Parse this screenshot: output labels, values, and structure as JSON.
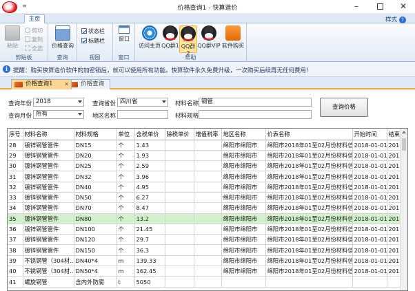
{
  "window": {
    "title": "价格查询1 - 快算造价",
    "qat": "≡",
    "min_icon": "–",
    "close_icon": "✕",
    "logo_text": "造价"
  },
  "ribbon": {
    "tabs": [
      "主页"
    ],
    "style_label": "样式",
    "help_q": "?",
    "groups": {
      "clipboard": {
        "label": "剪贴板",
        "paste": "粘贴",
        "cut": "剪切",
        "copy": "复制",
        "select_all": "全选"
      },
      "query": {
        "label": "查询",
        "price_query": "价格查询"
      },
      "view": {
        "label": "视图",
        "status_bar": "状态栏",
        "title_bar": "标题栏"
      },
      "window": {
        "label": "窗口",
        "window_btn": "窗口",
        "window_btn2": "窗口"
      },
      "help": {
        "label": "帮助",
        "home": "访问主页",
        "qq1": "QQ群1",
        "qq2": "QQ群2",
        "qq_vip": "QQ群VIP",
        "buy": "软件购买"
      }
    }
  },
  "notice": {
    "icon": "i",
    "text": "提醒：购买快算造价软件的加密锁后，就可以使用所有功能。快算软件永久免费升级，一次购买后续再无任何费用！"
  },
  "doc_tabs": [
    {
      "label": "价格查询1",
      "close": "✕"
    },
    {
      "label": "价格查询2"
    }
  ],
  "query": {
    "year_label": "查询年份",
    "year_value": "2018",
    "province_label": "查询省份",
    "province_value": "四川省",
    "month_label": "查询月份",
    "month_value": "所有",
    "region_label": "地区名称",
    "region_value": "",
    "material_label": "材料名称",
    "material_value": "钢管",
    "spec_label": "材料规格",
    "spec_value": "",
    "search_button": "查询价格"
  },
  "table": {
    "columns": [
      "序号",
      "材料名称",
      "材料规格",
      "单位",
      "含税单价",
      "除税单价",
      "增值税率",
      "地区名称",
      "价表名称",
      "开始时间",
      "结束"
    ],
    "rows": [
      [
        "28",
        "镀锌钢管管件",
        "DN15",
        "个",
        "1.43",
        "",
        "",
        "绵阳市绵阳市",
        "绵阳市2018年01至02月份材料信息",
        "2018-01-01",
        "2018"
      ],
      [
        "29",
        "镀锌钢管管件",
        "DN20",
        "个",
        "1.93",
        "",
        "",
        "绵阳市绵阳市",
        "绵阳市2018年01至02月份材料信息",
        "2018-01-01",
        "2018"
      ],
      [
        "30",
        "镀锌钢管管件",
        "DN25",
        "个",
        "2.59",
        "",
        "",
        "绵阳市绵阳市",
        "绵阳市2018年01至02月份材料信息",
        "2018-01-01",
        "2018"
      ],
      [
        "31",
        "镀锌钢管管件",
        "DN32",
        "个",
        "3.96",
        "",
        "",
        "绵阳市绵阳市",
        "绵阳市2018年01至02月份材料信息",
        "2018-01-01",
        "2018"
      ],
      [
        "32",
        "镀锌钢管管件",
        "DN40",
        "个",
        "4.95",
        "",
        "",
        "绵阳市绵阳市",
        "绵阳市2018年01至02月份材料信息",
        "2018-01-01",
        "2018"
      ],
      [
        "33",
        "镀锌钢管管件",
        "DN50",
        "个",
        "6.27",
        "",
        "",
        "绵阳市绵阳市",
        "绵阳市2018年01至02月份材料信息",
        "2018-01-01",
        "2018"
      ],
      [
        "34",
        "镀锌钢管管件",
        "DN70",
        "个",
        "8.47",
        "",
        "",
        "绵阳市绵阳市",
        "绵阳市2018年01至02月份材料信息",
        "2018-01-01",
        "2018"
      ],
      [
        "35",
        "镀锌钢管管件",
        "DN80",
        "个",
        "13.2",
        "",
        "",
        "绵阳市绵阳市",
        "绵阳市2018年01至02月份材料信息",
        "2018-01-01",
        "2018"
      ],
      [
        "36",
        "镀锌钢管管件",
        "DN100",
        "个",
        "21.45",
        "",
        "",
        "绵阳市绵阳市",
        "绵阳市2018年01至02月份材料信息",
        "2018-01-01",
        "2018"
      ],
      [
        "37",
        "镀锌钢管管件",
        "DN120",
        "个",
        "29.7",
        "",
        "",
        "绵阳市绵阳市",
        "绵阳市2018年01至02月份材料信息",
        "2018-01-01",
        "2018"
      ],
      [
        "38",
        "镀锌钢管管件",
        "DN150",
        "个",
        "36.3",
        "",
        "",
        "绵阳市绵阳市",
        "绵阳市2018年01至02月份材料信息",
        "2018-01-01",
        "2018"
      ],
      [
        "39",
        "不锈钢管（304材...",
        "DN40*4",
        "m",
        "139.33",
        "",
        "",
        "绵阳市绵阳市",
        "绵阳市2018年01至02月份材料信息",
        "2018-01-01",
        "2018"
      ],
      [
        "40",
        "不锈钢管（304材...",
        "DN50*4",
        "m",
        "162.45",
        "",
        "",
        "绵阳市绵阳市",
        "绵阳市2018年01至02月份材料信息",
        "2018-01-01",
        "2018"
      ],
      [
        "41",
        "螺旋钢管",
        "含内外防腐",
        "t",
        "5050",
        "",
        "",
        "",
        "",
        "",
        ""
      ]
    ],
    "selected_row_index": 7
  }
}
